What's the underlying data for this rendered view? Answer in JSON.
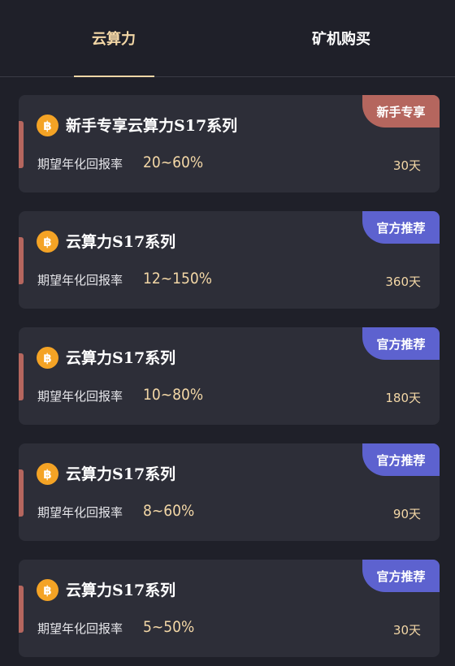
{
  "tabs": [
    {
      "label": "云算力",
      "active": true
    },
    {
      "label": "矿机购买",
      "active": false
    }
  ],
  "colors": {
    "accent": "#f3d7a6",
    "background": "#1f2029",
    "card": "#2d2e38",
    "badge_newbie": "#b5665e",
    "badge_official": "#5d62cf",
    "coin": "#f4a325"
  },
  "products": [
    {
      "title": "新手专享云算力S17系列",
      "rate_label": "期望年化回报率",
      "rate": "20~60%",
      "days": "30天",
      "badge": "新手专享",
      "badge_type": "newbie",
      "icon": "bitcoin-icon"
    },
    {
      "title": "云算力S17系列",
      "rate_label": "期望年化回报率",
      "rate": "12~150%",
      "days": "360天",
      "badge": "官方推荐",
      "badge_type": "official",
      "icon": "bitcoin-icon"
    },
    {
      "title": "云算力S17系列",
      "rate_label": "期望年化回报率",
      "rate": "10~80%",
      "days": "180天",
      "badge": "官方推荐",
      "badge_type": "official",
      "icon": "bitcoin-icon"
    },
    {
      "title": "云算力S17系列",
      "rate_label": "期望年化回报率",
      "rate": "8~60%",
      "days": "90天",
      "badge": "官方推荐",
      "badge_type": "official",
      "icon": "bitcoin-icon"
    },
    {
      "title": "云算力S17系列",
      "rate_label": "期望年化回报率",
      "rate": "5~50%",
      "days": "30天",
      "badge": "官方推荐",
      "badge_type": "official",
      "icon": "bitcoin-icon"
    }
  ]
}
